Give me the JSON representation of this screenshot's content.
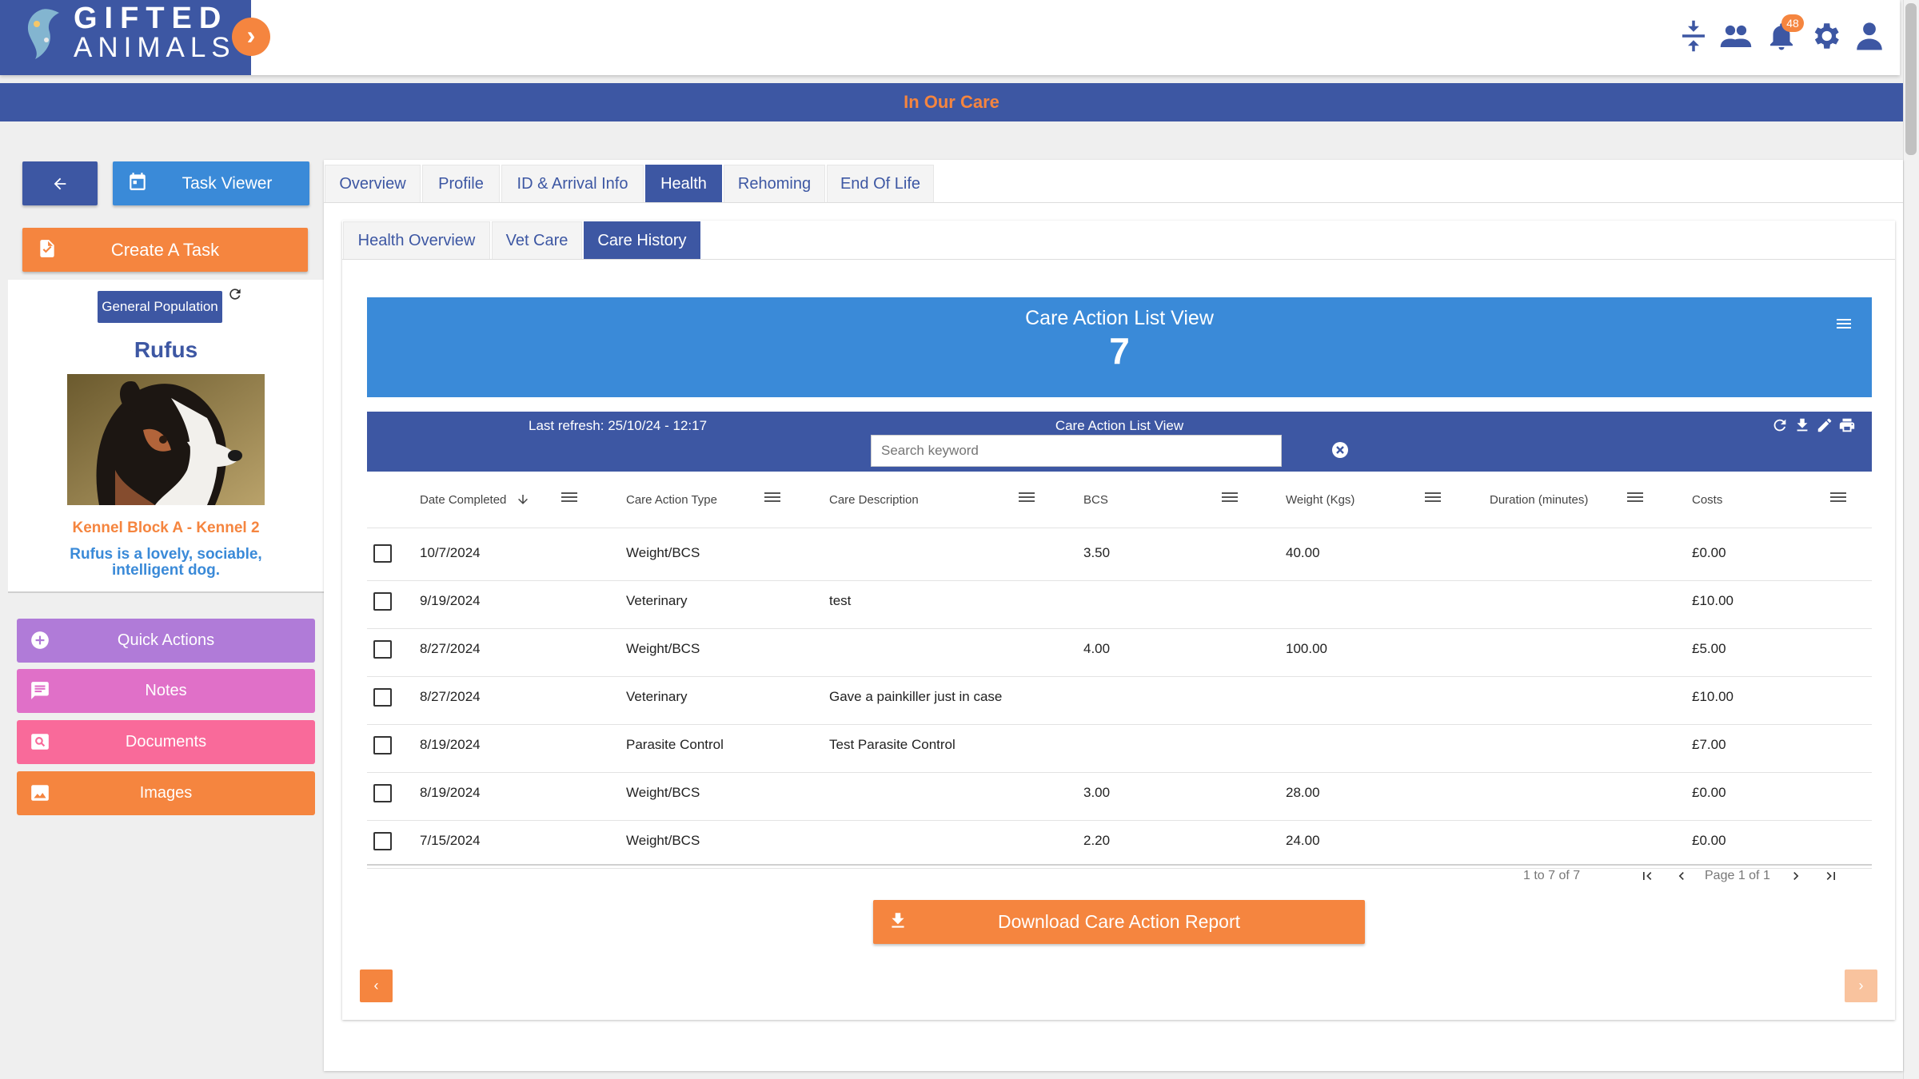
{
  "app": {
    "logo_line1": "GIFTED",
    "logo_line2": "ANIMALS"
  },
  "header": {
    "banner_title": "In Our Care",
    "notification_count": "48"
  },
  "left": {
    "task_viewer_label": "Task Viewer",
    "create_task_label": "Create A Task",
    "population_badge": "General Population",
    "animal_name": "Rufus",
    "kennel": "Kennel Block A - Kennel 2",
    "bio": "Rufus is a lovely, sociable, intelligent dog.",
    "actions": {
      "quick": "Quick Actions",
      "notes": "Notes",
      "documents": "Documents",
      "images": "Images"
    }
  },
  "tabs": [
    "Overview",
    "Profile",
    "ID & Arrival Info",
    "Health",
    "Rehoming",
    "End Of Life"
  ],
  "subtabs": [
    "Health Overview",
    "Vet Care",
    "Care History"
  ],
  "list_view": {
    "title": "Care Action List View",
    "count": "7",
    "last_refresh": "Last refresh: 25/10/24 - 12:17",
    "toolbar_title": "Care Action List View",
    "search_placeholder": "Search keyword"
  },
  "table": {
    "columns": [
      "Date Completed",
      "Care Action Type",
      "Care Description",
      "BCS",
      "Weight (Kgs)",
      "Duration (minutes)",
      "Costs"
    ],
    "rows": [
      {
        "date": "10/7/2024",
        "type": "Weight/BCS",
        "desc": "",
        "bcs": "3.50",
        "weight": "40.00",
        "duration": "",
        "cost": "£0.00"
      },
      {
        "date": "9/19/2024",
        "type": "Veterinary",
        "desc": "test",
        "bcs": "",
        "weight": "",
        "duration": "",
        "cost": "£10.00"
      },
      {
        "date": "8/27/2024",
        "type": "Weight/BCS",
        "desc": "",
        "bcs": "4.00",
        "weight": "100.00",
        "duration": "",
        "cost": "£5.00"
      },
      {
        "date": "8/27/2024",
        "type": "Veterinary",
        "desc": "Gave a painkiller just in case",
        "bcs": "",
        "weight": "",
        "duration": "",
        "cost": "£10.00"
      },
      {
        "date": "8/19/2024",
        "type": "Parasite Control",
        "desc": "Test Parasite Control",
        "bcs": "",
        "weight": "",
        "duration": "",
        "cost": "£7.00"
      },
      {
        "date": "8/19/2024",
        "type": "Weight/BCS",
        "desc": "",
        "bcs": "3.00",
        "weight": "28.00",
        "duration": "",
        "cost": "£0.00"
      },
      {
        "date": "7/15/2024",
        "type": "Weight/BCS",
        "desc": "",
        "bcs": "2.20",
        "weight": "24.00",
        "duration": "",
        "cost": "£0.00"
      }
    ],
    "pager_range": "1 to 7 of 7",
    "pager_page": "Page 1 of 1"
  },
  "download_label": "Download Care Action Report",
  "colors": {
    "brand_blue": "#3d57a3",
    "accent_orange": "#f5853f",
    "light_blue": "#3a8ad8"
  },
  "icons": [
    "collapse-icon",
    "users-icon",
    "bell-icon",
    "gear-icon",
    "user-icon",
    "arrow-left-icon",
    "calendar-icon",
    "task-icon",
    "refresh-icon",
    "plus-circle-icon",
    "comment-icon",
    "search-doc-icon",
    "image-icon",
    "menu-icon",
    "download-icon",
    "edit-icon",
    "print-icon",
    "clear-icon",
    "sort-down-icon"
  ]
}
